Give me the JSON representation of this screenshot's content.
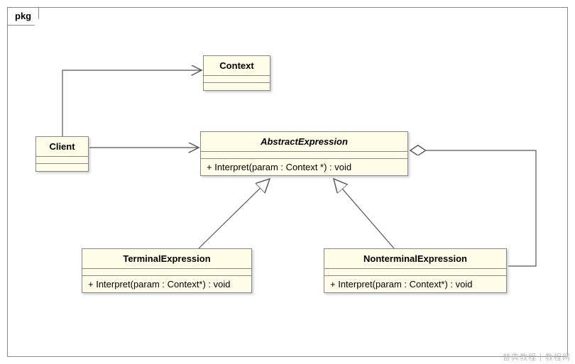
{
  "package": {
    "name": "pkg"
  },
  "classes": {
    "context": {
      "name": "Context",
      "abstract": false,
      "operations": []
    },
    "client": {
      "name": "Client",
      "abstract": false,
      "operations": []
    },
    "abstract_expression": {
      "name": "AbstractExpression",
      "abstract": true,
      "operations": [
        "+ Interpret(param : Context *) : void"
      ]
    },
    "terminal_expression": {
      "name": "TerminalExpression",
      "abstract": false,
      "operations": [
        "+ Interpret(param : Context*) : void"
      ]
    },
    "nonterminal_expression": {
      "name": "NonterminalExpression",
      "abstract": false,
      "operations": [
        "+ Interpret(param : Context*) : void"
      ]
    }
  },
  "relationships": [
    {
      "from": "client",
      "to": "context",
      "type": "dependency"
    },
    {
      "from": "client",
      "to": "abstract_expression",
      "type": "dependency"
    },
    {
      "from": "terminal_expression",
      "to": "abstract_expression",
      "type": "generalization"
    },
    {
      "from": "nonterminal_expression",
      "to": "abstract_expression",
      "type": "generalization"
    },
    {
      "from": "nonterminal_expression",
      "to": "abstract_expression",
      "type": "aggregation"
    }
  ],
  "watermark": "替典教程 | 教程网"
}
